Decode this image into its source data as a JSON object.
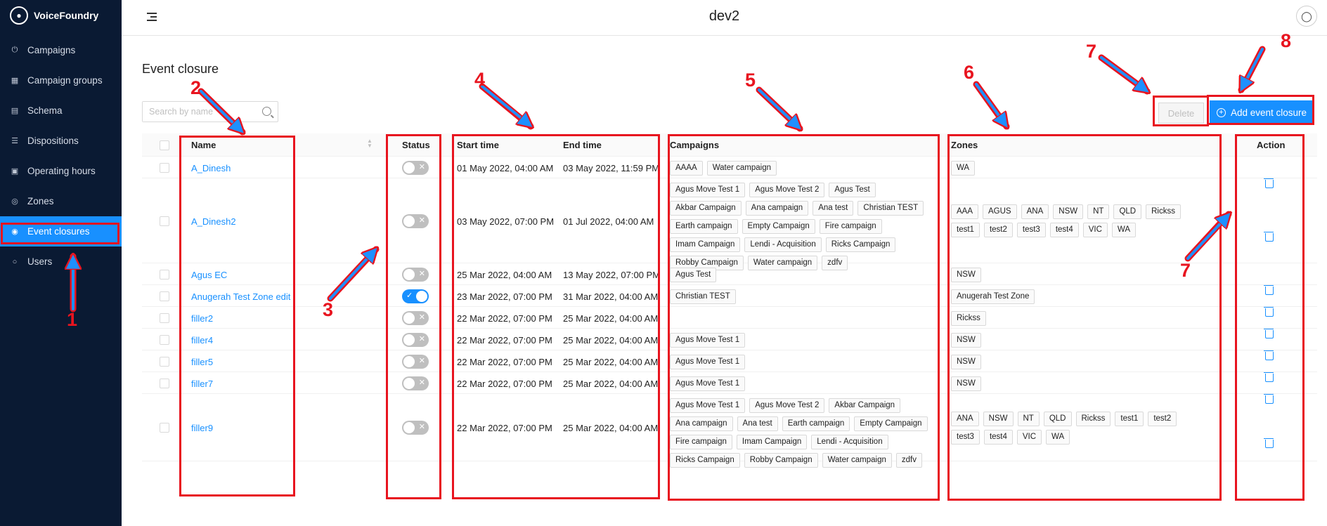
{
  "brand": {
    "name": "VoiceFoundry"
  },
  "sidebar": {
    "items": [
      {
        "label": "Campaigns",
        "icon": "power-icon"
      },
      {
        "label": "Campaign groups",
        "icon": "grid-icon"
      },
      {
        "label": "Schema",
        "icon": "schema-icon"
      },
      {
        "label": "Dispositions",
        "icon": "list-icon"
      },
      {
        "label": "Operating hours",
        "icon": "calendar-icon"
      },
      {
        "label": "Zones",
        "icon": "location-icon"
      },
      {
        "label": "Event closures",
        "icon": "event-icon",
        "active": true
      },
      {
        "label": "Users",
        "icon": "user-icon"
      }
    ]
  },
  "header": {
    "title": "dev2"
  },
  "page": {
    "title": "Event closure"
  },
  "search": {
    "placeholder": "Search by name"
  },
  "toolbar": {
    "delete_label": "Delete",
    "add_label": "Add event closure"
  },
  "columns": {
    "name": "Name",
    "status": "Status",
    "start": "Start time",
    "end": "End time",
    "campaigns": "Campaigns",
    "zones": "Zones",
    "action": "Action"
  },
  "rows": [
    {
      "name": "A_Dinesh",
      "status": false,
      "start": "01 May 2022, 04:00 AM",
      "end": "03 May 2022, 11:59 PM",
      "campaigns": [
        "AAAA",
        "Water campaign"
      ],
      "zones": [
        "WA"
      ]
    },
    {
      "name": "A_Dinesh2",
      "status": false,
      "start": "03 May 2022, 07:00 PM",
      "end": "01 Jul 2022, 04:00 AM",
      "campaigns": [
        "Agus Move Test 1",
        "Agus Move Test 2",
        "Agus Test",
        "Akbar Campaign",
        "Ana campaign",
        "Ana test",
        "Christian TEST",
        "Earth campaign",
        "Empty Campaign",
        "Fire campaign",
        "Imam Campaign",
        "Lendi - Acquisition",
        "Ricks Campaign",
        "Robby Campaign",
        "Water campaign",
        "zdfv"
      ],
      "zones": [
        "AAA",
        "AGUS",
        "ANA",
        "NSW",
        "NT",
        "QLD",
        "Rickss",
        "test1",
        "test2",
        "test3",
        "test4",
        "VIC",
        "WA"
      ]
    },
    {
      "name": "Agus EC",
      "status": false,
      "start": "25 Mar 2022, 04:00 AM",
      "end": "13 May 2022, 07:00 PM",
      "campaigns": [
        "Agus Test"
      ],
      "zones": [
        "NSW"
      ]
    },
    {
      "name": "Anugerah Test Zone edit",
      "status": true,
      "start": "23 Mar 2022, 07:00 PM",
      "end": "31 Mar 2022, 04:00 AM",
      "campaigns": [
        "Christian TEST"
      ],
      "zones": [
        "Anugerah Test Zone"
      ]
    },
    {
      "name": "filler2",
      "status": false,
      "start": "22 Mar 2022, 07:00 PM",
      "end": "25 Mar 2022, 04:00 AM",
      "campaigns": [],
      "zones": [
        "Rickss"
      ]
    },
    {
      "name": "filler4",
      "status": false,
      "start": "22 Mar 2022, 07:00 PM",
      "end": "25 Mar 2022, 04:00 AM",
      "campaigns": [
        "Agus Move Test 1"
      ],
      "zones": [
        "NSW"
      ]
    },
    {
      "name": "filler5",
      "status": false,
      "start": "22 Mar 2022, 07:00 PM",
      "end": "25 Mar 2022, 04:00 AM",
      "campaigns": [
        "Agus Move Test 1"
      ],
      "zones": [
        "NSW"
      ]
    },
    {
      "name": "filler7",
      "status": false,
      "start": "22 Mar 2022, 07:00 PM",
      "end": "25 Mar 2022, 04:00 AM",
      "campaigns": [
        "Agus Move Test 1"
      ],
      "zones": [
        "NSW"
      ]
    },
    {
      "name": "filler9",
      "status": false,
      "start": "22 Mar 2022, 07:00 PM",
      "end": "25 Mar 2022, 04:00 AM",
      "campaigns": [
        "Agus Move Test 1",
        "Agus Move Test 2",
        "Akbar Campaign",
        "Ana campaign",
        "Ana test",
        "Earth campaign",
        "Empty Campaign",
        "Fire campaign",
        "Imam Campaign",
        "Lendi - Acquisition",
        "Ricks Campaign",
        "Robby Campaign",
        "Water campaign",
        "zdfv"
      ],
      "zones": [
        "ANA",
        "NSW",
        "NT",
        "QLD",
        "Rickss",
        "test1",
        "test2",
        "test3",
        "test4",
        "VIC",
        "WA"
      ]
    }
  ],
  "annotations": [
    "1",
    "2",
    "3",
    "4",
    "5",
    "6",
    "7",
    "7",
    "8"
  ],
  "colors": {
    "sidebar_bg": "#0a1a33",
    "accent": "#1890ff",
    "annotation": "#e8141f"
  }
}
